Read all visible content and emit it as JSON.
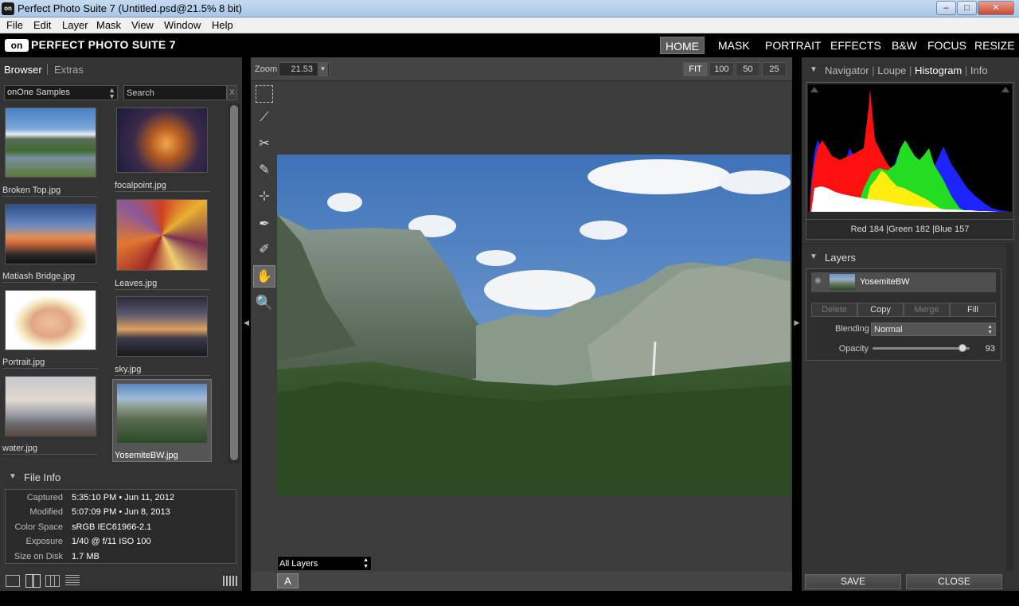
{
  "window": {
    "title": "Perfect Photo Suite 7 (Untitled.psd@21.5% 8 bit)",
    "minimize": "–",
    "maximize": "□",
    "close": "✕"
  },
  "menu": [
    "File",
    "Edit",
    "Layer",
    "Mask",
    "View",
    "Window",
    "Help"
  ],
  "app": {
    "logo": "on",
    "name": "PERFECT PHOTO SUITE 7",
    "tabs": [
      "HOME",
      "MASK",
      "PORTRAIT",
      "EFFECTS",
      "B&W",
      "FOCUS",
      "RESIZE"
    ],
    "active_tab": "HOME"
  },
  "browser": {
    "tabs": [
      "Browser",
      "Extras"
    ],
    "folder": "onOne Samples",
    "search_placeholder": "Search",
    "search_clear": "X",
    "thumbnails": [
      "Broken Top.jpg",
      "focalpoint.jpg",
      "Matiash Bridge.jpg",
      "Leaves.jpg",
      "Portrait.jpg",
      "sky.jpg",
      "water.jpg",
      "YosemiteBW.jpg"
    ],
    "selected": "YosemiteBW.jpg"
  },
  "file_info": {
    "title": "File Info",
    "rows": [
      {
        "label": "Captured",
        "value": "5:35:10 PM • Jun 11, 2012"
      },
      {
        "label": "Modified",
        "value": "5:07:09 PM • Jun 8, 2013"
      },
      {
        "label": "Color Space",
        "value": "sRGB IEC61966-2.1"
      },
      {
        "label": "Exposure",
        "value": "1/40 @ f/11  ISO 100"
      },
      {
        "label": "Size on Disk",
        "value": "1.7 MB"
      }
    ]
  },
  "canvas": {
    "zoom_label": "Zoom",
    "zoom_value": "21.53",
    "zoom_presets": [
      "FIT",
      "100",
      "50",
      "25"
    ],
    "layer_select": "All Layers",
    "a_button": "A"
  },
  "navigator": {
    "tabs": [
      "Navigator",
      "Loupe",
      "Histogram",
      "Info"
    ],
    "active": "Histogram",
    "readout": "Red 184  |Green 182  |Blue 157"
  },
  "layers": {
    "title": "Layers",
    "items": [
      "YosemiteBW"
    ],
    "buttons": [
      "Delete",
      "Copy",
      "Merge",
      "Fill"
    ],
    "blending_label": "Blending",
    "blending_value": "Normal",
    "opacity_label": "Opacity",
    "opacity_value": "93",
    "opacity_fraction": 0.93
  },
  "footer": {
    "save": "SAVE",
    "close": "CLOSE"
  },
  "colors": {
    "panel": "#333333",
    "canvas_bg": "#3c3c3c",
    "accent_active_tab": "#5a5a5a"
  }
}
